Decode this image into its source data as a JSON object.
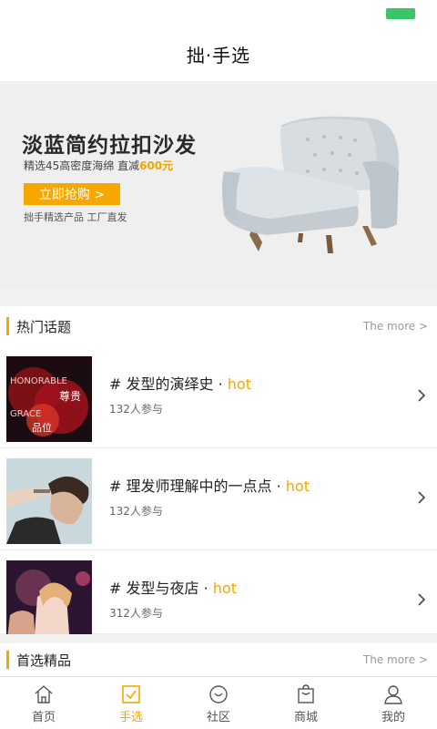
{
  "header": {
    "title": "拙·手选"
  },
  "banner": {
    "headline": "淡蓝简约拉扣沙发",
    "subtitle": "精选45高密度海绵 直减",
    "discount": "600元",
    "button_label": "立即抢购 >",
    "note": "拙手精选产品 工厂直发"
  },
  "hot_topics": {
    "title": "热门话题",
    "more_label": "The more >",
    "items": [
      {
        "title": "# 发型的演绎史 ·",
        "hot": "hot",
        "count": "132人参与",
        "thumb_text_1": "HONORABLE",
        "thumb_text_2": "尊贵",
        "thumb_text_3": "GRACE",
        "thumb_text_4": "品位"
      },
      {
        "title": "# 理发师理解中的一点点 ·",
        "hot": "hot",
        "count": "132人参与"
      },
      {
        "title": "# 发型与夜店 ·",
        "hot": "hot",
        "count": "312人参与"
      }
    ]
  },
  "featured": {
    "title": "首选精品",
    "more_label": "The more >"
  },
  "tabs": [
    {
      "label": "首页",
      "icon": "home-icon",
      "active": false
    },
    {
      "label": "手选",
      "icon": "checkbox-icon",
      "active": true
    },
    {
      "label": "社区",
      "icon": "community-icon",
      "active": false
    },
    {
      "label": "商城",
      "icon": "shopping-bag-icon",
      "active": false
    },
    {
      "label": "我的",
      "icon": "person-icon",
      "active": false
    }
  ],
  "colors": {
    "accent": "#f6a800",
    "battery": "#3cc46b"
  }
}
